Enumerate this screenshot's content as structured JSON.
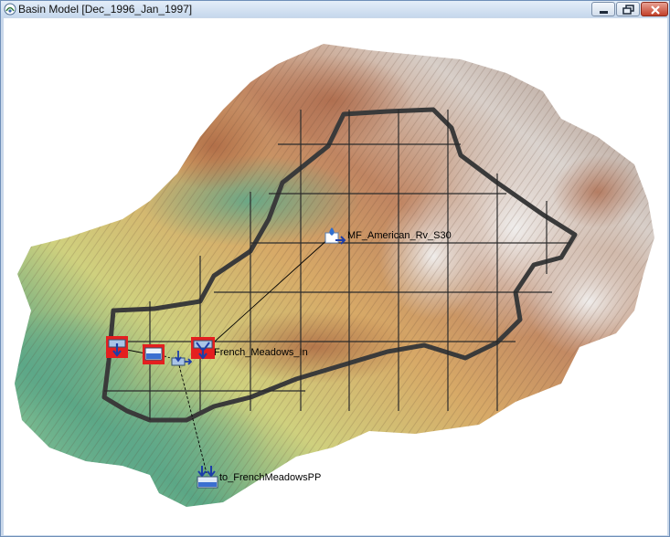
{
  "window": {
    "title": "Basin Model [Dec_1996_Jan_1997]",
    "controls": [
      "minimize",
      "restore",
      "close"
    ]
  },
  "map": {
    "elements": [
      {
        "name": "MF_American_Rv_S30",
        "type": "subbasin"
      },
      {
        "name": "French_Meadows_In",
        "type": "junction"
      },
      {
        "name": "to_FrenchMeadowsPP",
        "type": "sink"
      }
    ],
    "unlabeled_elements": [
      "reservoir",
      "reservoir",
      "diversion",
      "junction"
    ],
    "grid": true
  },
  "colors": {
    "titlebar": "#d6e3f2",
    "boundary": "#3a3a3a",
    "grid": "#2b2b2b",
    "terrain_low": "#4e9e86",
    "terrain_mid": "#d7c06a",
    "terrain_high": "#b9764c",
    "terrain_peak": "#e8e8e8"
  }
}
